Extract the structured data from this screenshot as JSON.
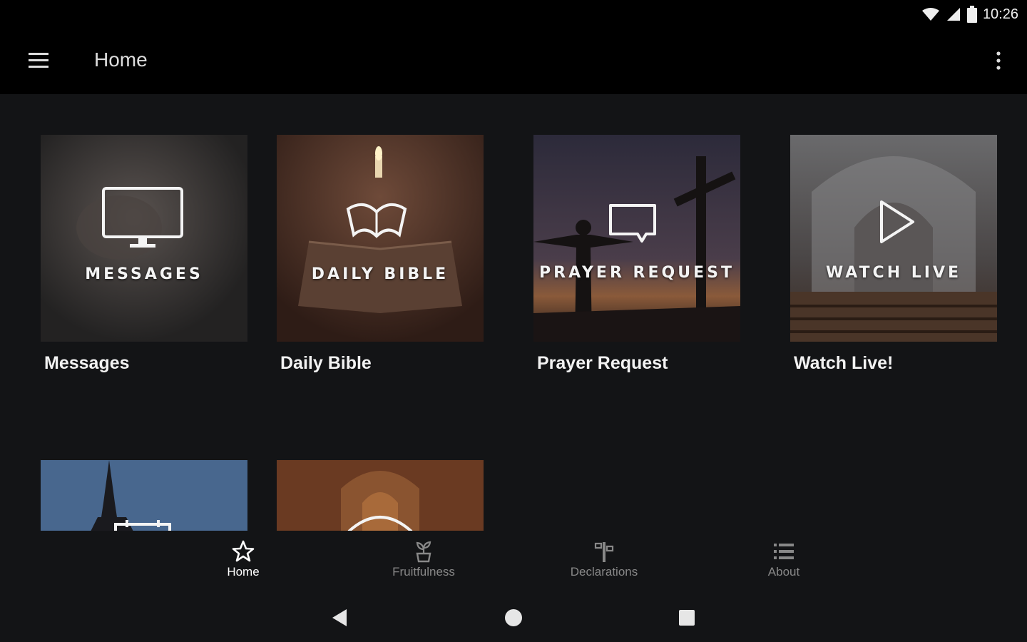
{
  "status_bar": {
    "time": "10:26"
  },
  "app_bar": {
    "title": "Home"
  },
  "cards": [
    {
      "title": "Messages",
      "overlay": "MESSAGES"
    },
    {
      "title": "Daily Bible",
      "overlay": "DAILY BIBLE"
    },
    {
      "title": "Prayer Request",
      "overlay": "PRAYER REQUEST"
    },
    {
      "title": "Watch Live!",
      "overlay": "WATCH LIVE"
    },
    {
      "title": "",
      "overlay": ""
    },
    {
      "title": "",
      "overlay": ""
    }
  ],
  "bottom_nav": {
    "active": "Home",
    "items": [
      {
        "label": "Home",
        "icon": "star-icon"
      },
      {
        "label": "Fruitfulness",
        "icon": "plant-icon"
      },
      {
        "label": "Declarations",
        "icon": "signpost-icon"
      },
      {
        "label": "About",
        "icon": "list-icon"
      }
    ]
  },
  "colors": {
    "background": "#131416",
    "bar": "#000000",
    "active_label": "#ffffff",
    "inactive_label": "#888888"
  }
}
